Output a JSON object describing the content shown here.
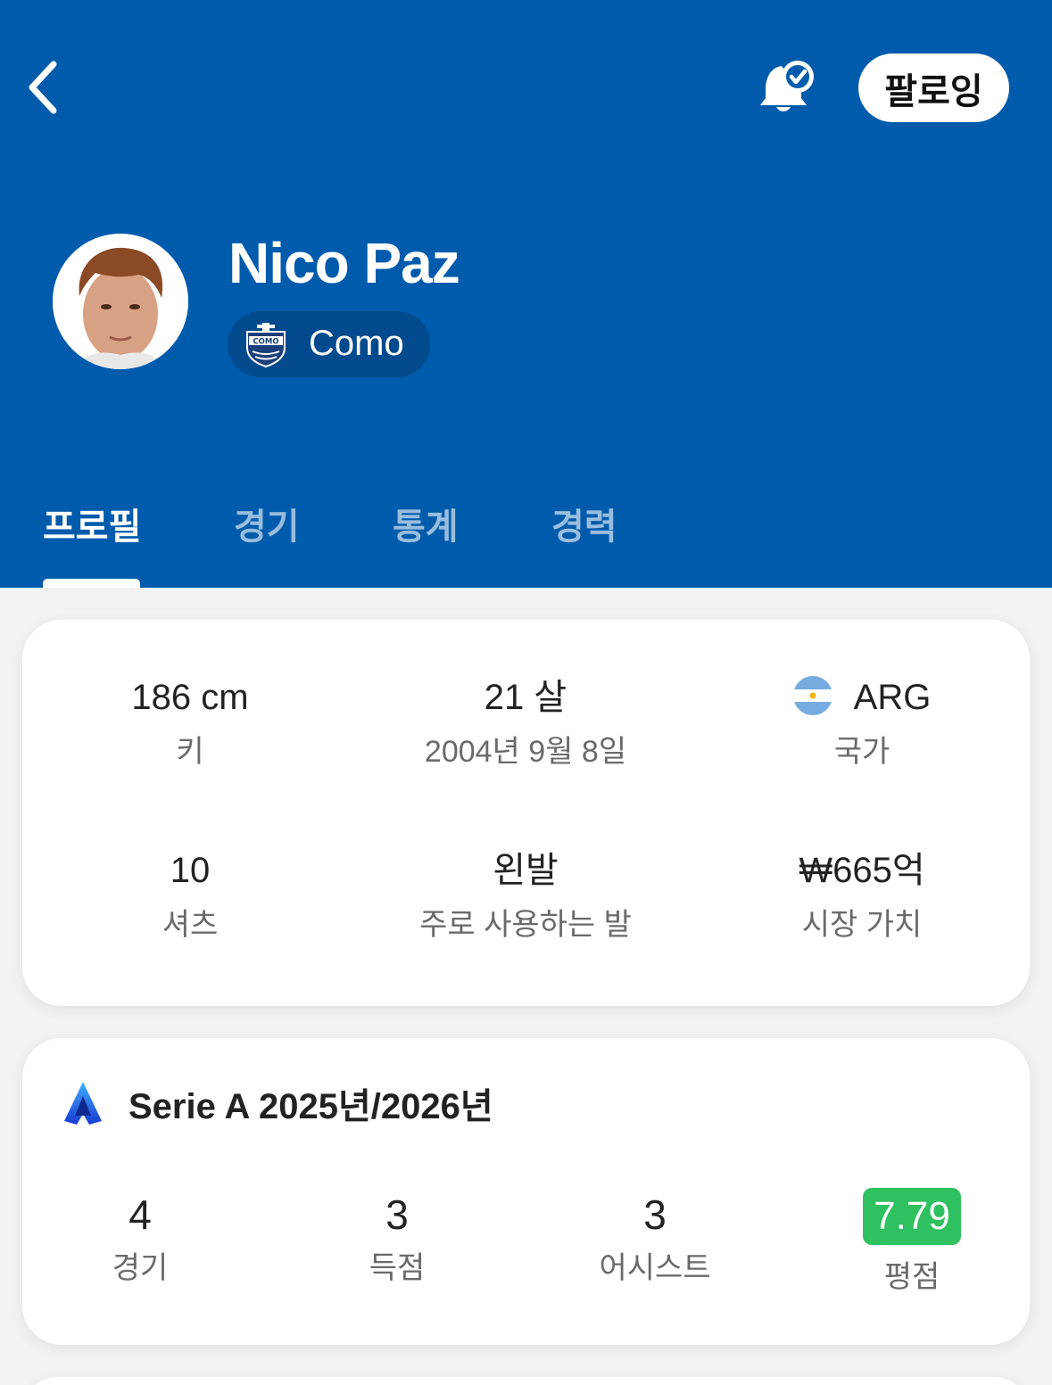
{
  "header": {
    "player_name": "Nico Paz",
    "team_name": "Como",
    "follow_label": "팔로잉",
    "background_color": "#005bac"
  },
  "tabs": [
    {
      "label": "프로필",
      "active": true
    },
    {
      "label": "경기",
      "active": false
    },
    {
      "label": "통계",
      "active": false
    },
    {
      "label": "경력",
      "active": false
    }
  ],
  "info": {
    "height": {
      "value": "186 cm",
      "label": "키"
    },
    "age": {
      "value": "21 살",
      "label": "2004년 9월 8일"
    },
    "country": {
      "value": "ARG",
      "label": "국가"
    },
    "shirt": {
      "value": "10",
      "label": "셔츠"
    },
    "foot": {
      "value": "왼발",
      "label": "주로 사용하는 발"
    },
    "market_value": {
      "value": "₩665억",
      "label": "시장 가치"
    }
  },
  "season": {
    "title": "Serie A 2025년/2026년",
    "stats": [
      {
        "value": "4",
        "label": "경기"
      },
      {
        "value": "3",
        "label": "득점"
      },
      {
        "value": "3",
        "label": "어시스트"
      },
      {
        "value": "7.79",
        "label": "평점"
      }
    ],
    "rating_color": "#2fc05f"
  },
  "icons": [
    "chevron-left-icon",
    "bell-check-icon",
    "player-photo",
    "como-crest-icon",
    "argentina-flag-icon",
    "serie-a-logo-icon"
  ]
}
